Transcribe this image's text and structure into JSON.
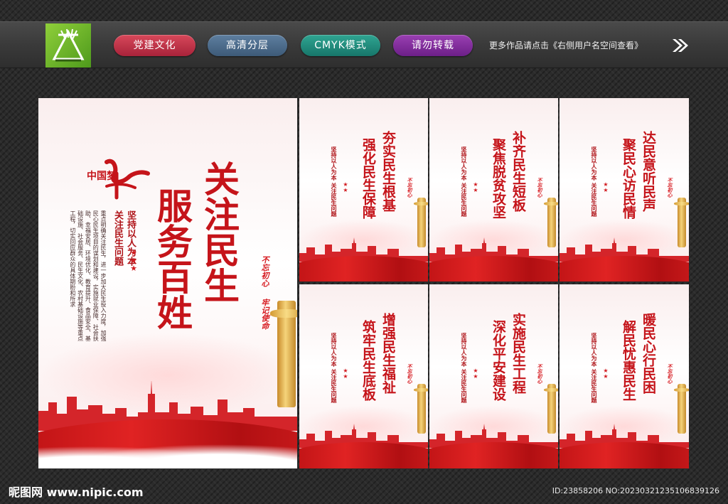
{
  "toolbar": {
    "tags": [
      "党建文化",
      "高清分层",
      "CMYK模式",
      "请勿转载"
    ],
    "more_text": "更多作品请点击《右侧用户名空间查看》",
    "logo_icon": "pen-nib-icon",
    "arrow_icon": "double-chevron-right-icon"
  },
  "main_poster": {
    "title_col1": "关注民生",
    "title_col2": "服务百姓",
    "subtitle_col1": "坚持以人为本",
    "subtitle_col2": "关注民生问题",
    "body_text": "重点明确关注民生，进一步加大民生投入力度，加强民心民生项目的谋划和建设，实施就业保障、社会扶助、幸福安居、环境优化、教育提升、食品安全、基础设施、社会服务、民生文化、农村基础设施等重点工程，切实回应群众的具体期盼和所求",
    "brush_mark": "中国梦",
    "seal_col1": "不忘初心",
    "seal_col2": "牢记使命"
  },
  "small_posters": [
    {
      "title_col1": "夯实民生根基",
      "title_col2": "强化民生保障",
      "subtitle": "坚持以人为本 关注民生问题",
      "seal": "不忘初心"
    },
    {
      "title_col1": "补齐民生短板",
      "title_col2": "聚焦脱贫攻坚",
      "subtitle": "坚持以人为本 关注民生问题",
      "seal": "不忘初心"
    },
    {
      "title_col1": "达民意听民声",
      "title_col2": "聚民心访民情",
      "subtitle": "坚持以人为本 关注民生问题",
      "seal": "不忘初心"
    },
    {
      "title_col1": "增强民生福祉",
      "title_col2": "筑牢民生底板",
      "subtitle": "坚持以人为本 关注民生问题",
      "seal": "不忘初心"
    },
    {
      "title_col1": "实施民生工程",
      "title_col2": "深化平安建设",
      "subtitle": "坚持以人为本 关注民生问题",
      "seal": "不忘初心"
    },
    {
      "title_col1": "暖民心行民困",
      "title_col2": "解民忧惠民生",
      "subtitle": "坚持以人为本 关注民生问题",
      "seal": "不忘初心"
    }
  ],
  "footer": {
    "site_logo": "昵图网 www.nipic.com",
    "image_id": "ID:23858206 NO:20230321235106839126"
  },
  "colors": {
    "accent_red": "#c5141a",
    "pill_red": "#c2304a",
    "pill_slate": "#4b6a8a",
    "pill_teal": "#1f8c7c",
    "pill_purple": "#822a9e",
    "logo_green": "#6fb52c"
  }
}
